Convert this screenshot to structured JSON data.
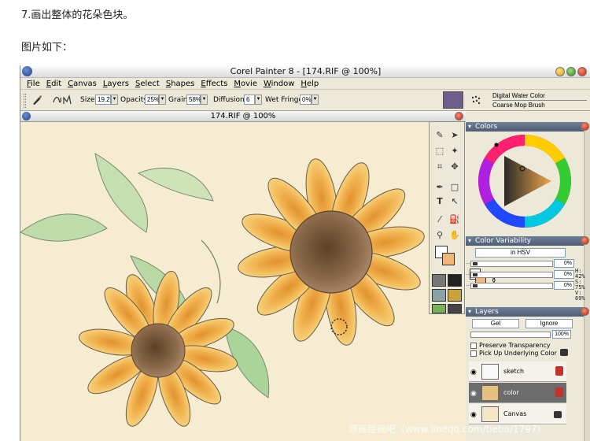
{
  "blog": {
    "step_text": "7.画出整体的花朵色块。",
    "caption": "图片如下："
  },
  "window": {
    "title": "Corel Painter 8 - [174.RIF @ 100%]"
  },
  "menu": {
    "items": [
      "File",
      "Edit",
      "Canvas",
      "Layers",
      "Select",
      "Shapes",
      "Effects",
      "Movie",
      "Window",
      "Help"
    ]
  },
  "property_bar": {
    "size_label": "Size:",
    "size_value": "19.2",
    "opacity_label": "Opacity:",
    "opacity_value": "25%",
    "grain_label": "Grain:",
    "grain_value": "58%",
    "diffusion_label": "Diffusion:",
    "diffusion_value": "6",
    "wet_fringe_label": "Wet Fringe:",
    "wet_fringe_value": "0%",
    "brush_category": "Digital Water Color",
    "brush_variant": "Coarse Mop Brush"
  },
  "document": {
    "title": "174.RIF @ 100%"
  },
  "colors_panel": {
    "title": "Colors",
    "h": "H: 42%",
    "s": "S: 75%",
    "v": "V: 69%",
    "main_color": "#f0b578"
  },
  "color_variability": {
    "title": "Color Variability",
    "mode": "in HSV",
    "rows": [
      "0%",
      "0%",
      "0%"
    ]
  },
  "layers": {
    "title": "Layers",
    "composite_method": "Gel",
    "depth_mode": "Ignore",
    "opacity": "100%",
    "preserve_transparency": "Preserve Transparency",
    "pick_up_underlying": "Pick Up Underlying Color",
    "items": [
      {
        "name": "sketch"
      },
      {
        "name": "color"
      },
      {
        "name": "Canvas"
      }
    ]
  },
  "watermark": "原画绘画吧（www.lineqq.com/tieba/1797）"
}
